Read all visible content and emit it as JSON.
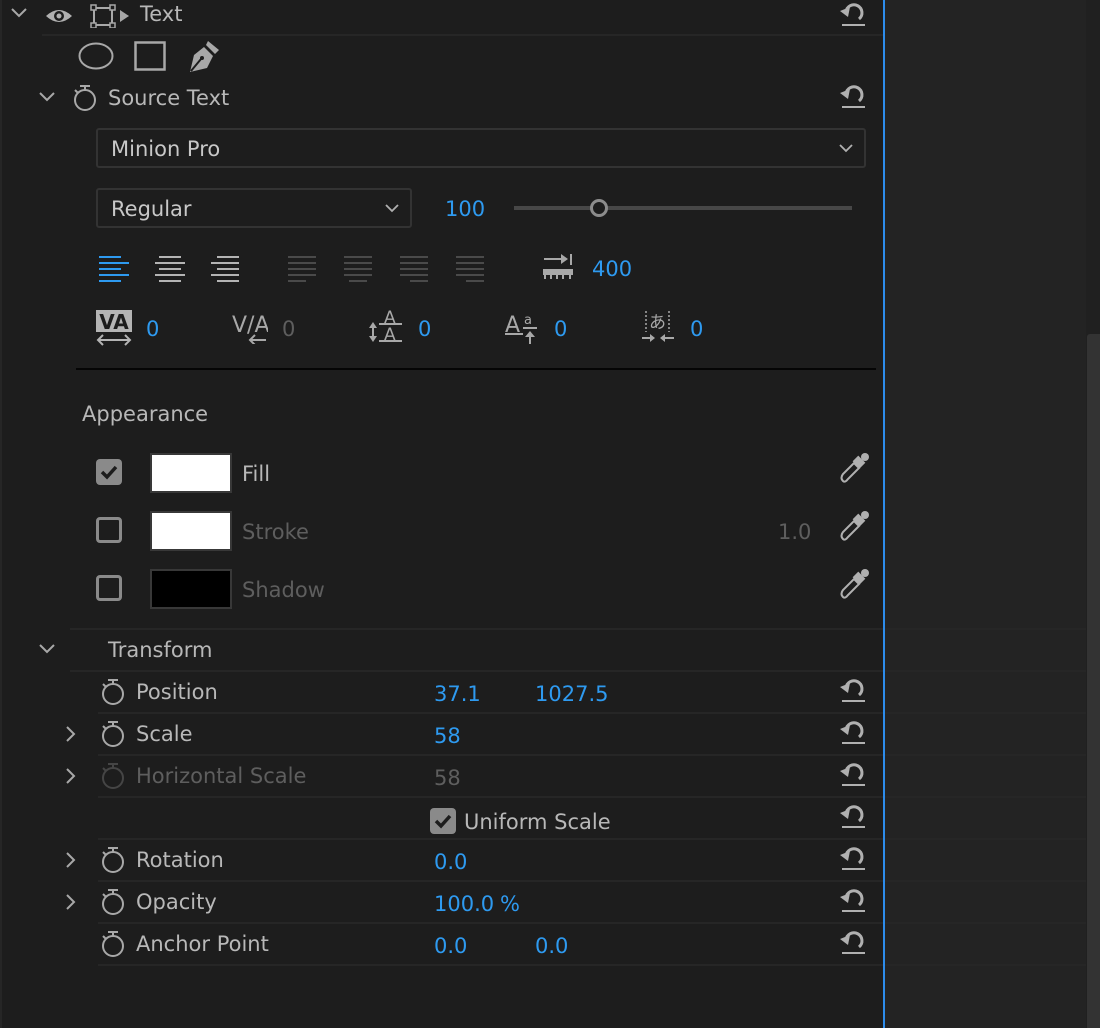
{
  "layer": {
    "name": "Text",
    "expanded": true
  },
  "source_text": {
    "label": "Source Text",
    "font_family": "Minion Pro",
    "font_style": "Regular",
    "font_size": "100",
    "font_size_slider_fraction": 0.25,
    "alignment": {
      "active": "align-left",
      "buttons": [
        "align-left",
        "align-center",
        "align-right",
        "justify-last-left",
        "justify-last-center",
        "justify-last-right",
        "justify-all"
      ]
    },
    "tab_width": "400",
    "kerning": "0",
    "tracking": "0",
    "leading": "0",
    "baseline_shift": "0",
    "tsume": "0"
  },
  "appearance": {
    "title": "Appearance",
    "fill": {
      "label": "Fill",
      "checked": true,
      "color": "#ffffff"
    },
    "stroke": {
      "label": "Stroke",
      "checked": false,
      "color": "#ffffff",
      "width": "1.0"
    },
    "shadow": {
      "label": "Shadow",
      "checked": false,
      "color": "#000000"
    }
  },
  "transform": {
    "title": "Transform",
    "position": {
      "label": "Position",
      "x": "37.1",
      "y": "1027.5"
    },
    "scale": {
      "label": "Scale",
      "value": "58"
    },
    "horizontal_scale": {
      "label": "Horizontal Scale",
      "value": "58"
    },
    "uniform_scale": {
      "label": "Uniform Scale",
      "checked": true
    },
    "rotation": {
      "label": "Rotation",
      "value": "0.0"
    },
    "opacity": {
      "label": "Opacity",
      "value": "100.0",
      "unit": "%"
    },
    "anchor_point": {
      "label": "Anchor Point",
      "x": "0.0",
      "y": "0.0"
    }
  },
  "colors": {
    "accent": "#2e9af0",
    "panel_bg": "#1d1d1d",
    "timeline_bg": "#232323"
  }
}
